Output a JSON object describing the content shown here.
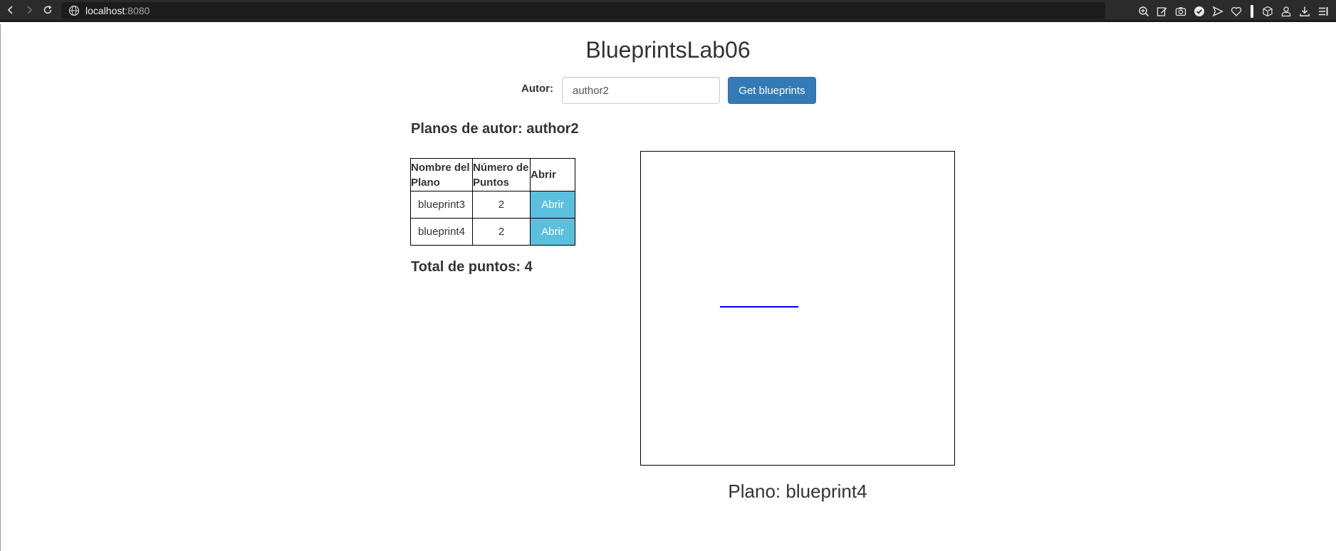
{
  "browser": {
    "url_host": "localhost",
    "url_port": ":8080",
    "toolbar_icons": [
      "zoom-icon",
      "edit-icon",
      "camera-icon",
      "shield-icon",
      "send-icon",
      "heart-icon",
      "box-icon",
      "account-icon",
      "download-icon",
      "menu-icon"
    ]
  },
  "page": {
    "title": "BlueprintsLab06",
    "author_label": "Autor:",
    "author_value": "author2",
    "get_button_label": "Get blueprints",
    "plans_heading": "Planos de autor: author2",
    "table": {
      "headers": [
        "Nombre del Plano",
        "Número de Puntos",
        "Abrir"
      ],
      "rows": [
        {
          "name": "blueprint3",
          "points": "2",
          "action": "Abrir"
        },
        {
          "name": "blueprint4",
          "points": "2",
          "action": "Abrir"
        }
      ]
    },
    "total_heading": "Total de puntos: 4",
    "plan_caption": "Plano: blueprint4"
  },
  "colors": {
    "primary_button": "#337ab7",
    "info_button": "#5bc0de",
    "drawn_line": "#0000ff"
  }
}
